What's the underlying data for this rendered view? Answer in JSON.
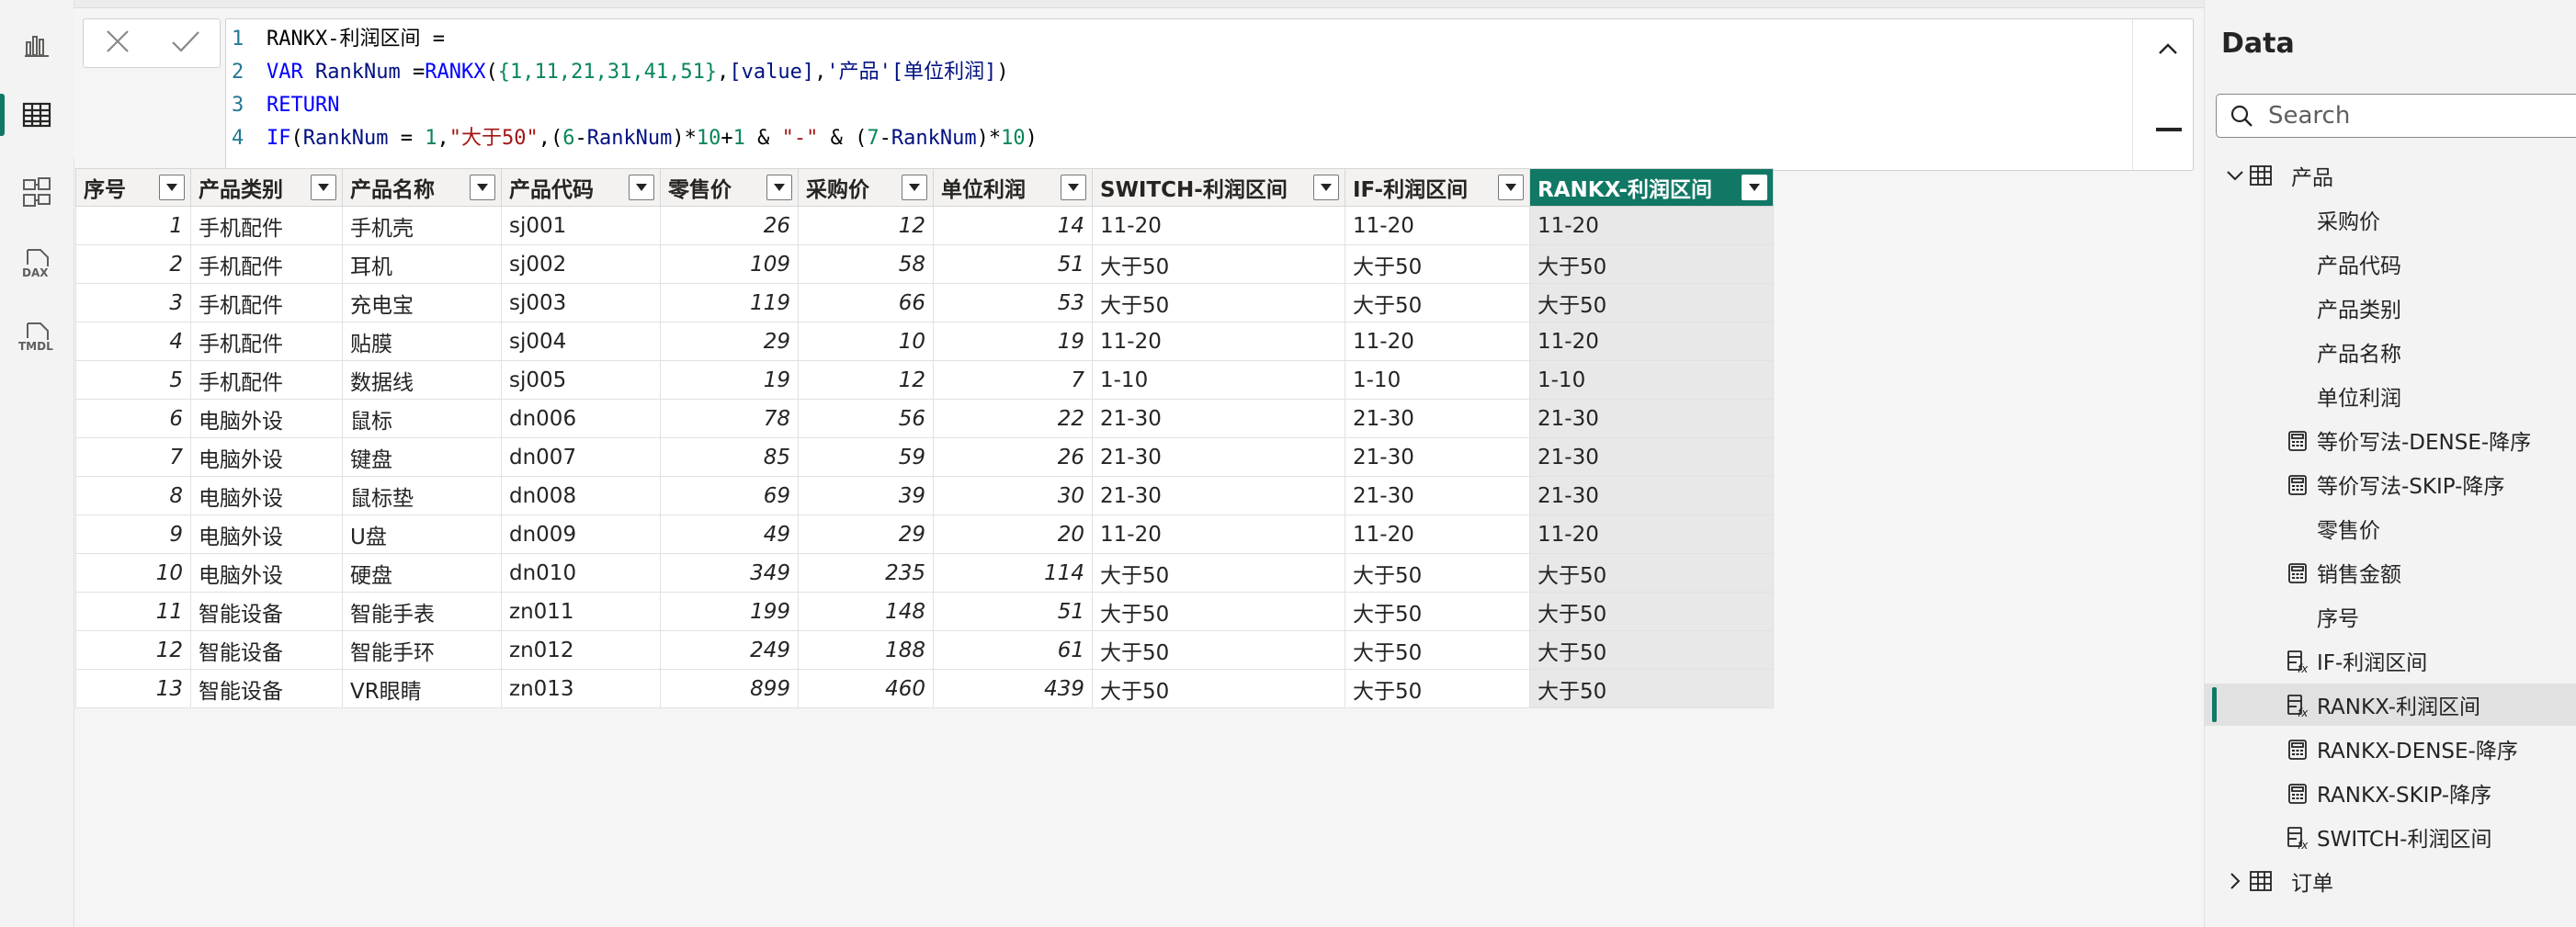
{
  "rail": {
    "items": [
      {
        "name": "report-view",
        "icon": "bar-chart-icon",
        "active": false
      },
      {
        "name": "table-view",
        "icon": "table-grid-icon",
        "active": true
      },
      {
        "name": "model-view",
        "icon": "model-diagram-icon",
        "active": false
      },
      {
        "name": "dax-query-view",
        "icon": "dax-icon",
        "active": false
      },
      {
        "name": "tmdl-view",
        "icon": "tmdl-icon",
        "active": false
      }
    ],
    "dax_label": "DAX",
    "tmdl_label": "TMDL"
  },
  "formula_bar": {
    "cancel_icon": "close-icon",
    "commit_icon": "check-icon",
    "line_numbers": [
      "1",
      "2",
      "3",
      "4"
    ],
    "line1": {
      "name": "RANKX-利润区间",
      "eq": " ="
    },
    "line2": {
      "var_kw": "VAR",
      "var_name": " RankNum ",
      "eq": "=",
      "fn": "RANKX",
      "open": "(",
      "set": "{1,11,21,31,41,51}",
      "comma1": ",",
      "bracket": "[value]",
      "comma2": ",",
      "table_ref": "'产品'",
      "col_ref": "[单位利润]",
      "close": ")"
    },
    "line3": {
      "kw": "RETURN"
    },
    "line4": {
      "fn": "IF",
      "p1": "(",
      "var1": "RankNum",
      "eq": " = ",
      "n1": "1",
      "c1": ",",
      "s1": "\"大于50\"",
      "c2": ",",
      "p2": "(",
      "n6": "6",
      "minus1": "-",
      "var2": "RankNum",
      "p3": ")",
      "mul1": "*",
      "n10a": "10",
      "plus": "+",
      "n1b": "1",
      "amp1": " & ",
      "s2": "\"-\"",
      "amp2": " & ",
      "p4": "(",
      "n7": "7",
      "minus2": "-",
      "var3": "RankNum",
      "p5": ")",
      "mul2": "*",
      "n10b": "10",
      "p6": ")"
    }
  },
  "table": {
    "columns": [
      "序号",
      "产品类别",
      "产品名称",
      "产品代码",
      "零售价",
      "采购价",
      "单位利润",
      "SWITCH-利润区间",
      "IF-利润区间",
      "RANKX-利润区间"
    ],
    "selected_column": "RANKX-利润区间",
    "rows": [
      [
        "1",
        "手机配件",
        "手机壳",
        "sj001",
        "26",
        "12",
        "14",
        "11-20",
        "11-20",
        "11-20"
      ],
      [
        "2",
        "手机配件",
        "耳机",
        "sj002",
        "109",
        "58",
        "51",
        "大于50",
        "大于50",
        "大于50"
      ],
      [
        "3",
        "手机配件",
        "充电宝",
        "sj003",
        "119",
        "66",
        "53",
        "大于50",
        "大于50",
        "大于50"
      ],
      [
        "4",
        "手机配件",
        "贴膜",
        "sj004",
        "29",
        "10",
        "19",
        "11-20",
        "11-20",
        "11-20"
      ],
      [
        "5",
        "手机配件",
        "数据线",
        "sj005",
        "19",
        "12",
        "7",
        "1-10",
        "1-10",
        "1-10"
      ],
      [
        "6",
        "电脑外设",
        "鼠标",
        "dn006",
        "78",
        "56",
        "22",
        "21-30",
        "21-30",
        "21-30"
      ],
      [
        "7",
        "电脑外设",
        "键盘",
        "dn007",
        "85",
        "59",
        "26",
        "21-30",
        "21-30",
        "21-30"
      ],
      [
        "8",
        "电脑外设",
        "鼠标垫",
        "dn008",
        "69",
        "39",
        "30",
        "21-30",
        "21-30",
        "21-30"
      ],
      [
        "9",
        "电脑外设",
        "U盘",
        "dn009",
        "49",
        "29",
        "20",
        "11-20",
        "11-20",
        "11-20"
      ],
      [
        "10",
        "电脑外设",
        "硬盘",
        "dn010",
        "349",
        "235",
        "114",
        "大于50",
        "大于50",
        "大于50"
      ],
      [
        "11",
        "智能设备",
        "智能手表",
        "zn011",
        "199",
        "148",
        "51",
        "大于50",
        "大于50",
        "大于50"
      ],
      [
        "12",
        "智能设备",
        "智能手环",
        "zn012",
        "249",
        "188",
        "61",
        "大于50",
        "大于50",
        "大于50"
      ],
      [
        "13",
        "智能设备",
        "VR眼睛",
        "zn013",
        "899",
        "460",
        "439",
        "大于50",
        "大于50",
        "大于50"
      ]
    ]
  },
  "data_pane": {
    "title": "Data",
    "search_placeholder": "Search",
    "tables": [
      {
        "label": "产品",
        "expanded": true,
        "fields": [
          {
            "label": "采购价",
            "icon": "none"
          },
          {
            "label": "产品代码",
            "icon": "none"
          },
          {
            "label": "产品类别",
            "icon": "none"
          },
          {
            "label": "产品名称",
            "icon": "none"
          },
          {
            "label": "单位利润",
            "icon": "none"
          },
          {
            "label": "等价写法-DENSE-降序",
            "icon": "calculator-icon"
          },
          {
            "label": "等价写法-SKIP-降序",
            "icon": "calculator-icon"
          },
          {
            "label": "零售价",
            "icon": "none"
          },
          {
            "label": "销售金额",
            "icon": "calculator-icon"
          },
          {
            "label": "序号",
            "icon": "none"
          },
          {
            "label": "IF-利润区间",
            "icon": "calculated-column-icon"
          },
          {
            "label": "RANKX-利润区间",
            "icon": "calculated-column-icon",
            "active": true
          },
          {
            "label": "RANKX-DENSE-降序",
            "icon": "calculator-icon"
          },
          {
            "label": "RANKX-SKIP-降序",
            "icon": "calculator-icon"
          },
          {
            "label": "SWITCH-利润区间",
            "icon": "calculated-column-icon"
          }
        ]
      },
      {
        "label": "订单",
        "expanded": false,
        "fields": []
      }
    ]
  },
  "colors": {
    "accent": "#117865",
    "keyword": "#0000ff",
    "string": "#a31515",
    "number": "#098658"
  }
}
